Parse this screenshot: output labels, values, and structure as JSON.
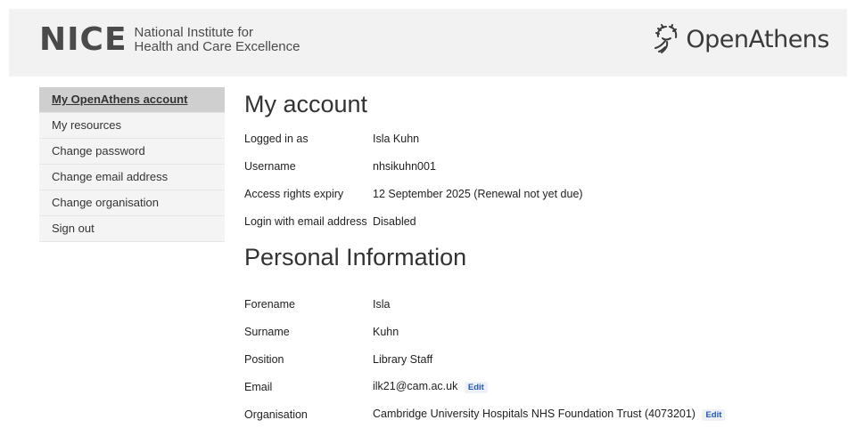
{
  "header": {
    "nice_logo_word": "NICE",
    "nice_line1": "National Institute for",
    "nice_line2": "Health and Care Excellence",
    "brand": "OpenAthens",
    "colors": {
      "header_bg": "#f2f2f2",
      "text": "#4a4a4a"
    }
  },
  "sidebar": {
    "items": [
      {
        "label": "My OpenAthens account",
        "active": true
      },
      {
        "label": "My resources"
      },
      {
        "label": "Change password"
      },
      {
        "label": "Change email address"
      },
      {
        "label": "Change organisation"
      },
      {
        "label": "Sign out"
      }
    ]
  },
  "account": {
    "title": "My account",
    "rows": [
      {
        "label": "Logged in as",
        "value": "Isla Kuhn"
      },
      {
        "label": "Username",
        "value": "nhsikuhn001"
      },
      {
        "label": "Access rights expiry",
        "value": "12 September 2025 (Renewal not yet due)"
      },
      {
        "label": "Login with email address",
        "value": "Disabled"
      }
    ]
  },
  "personal": {
    "title": "Personal Information",
    "rows": [
      {
        "label": "Forename",
        "value": "Isla"
      },
      {
        "label": "Surname",
        "value": "Kuhn"
      },
      {
        "label": "Position",
        "value": "Library Staff"
      },
      {
        "label": "Email",
        "value": "ilk21@cam.ac.uk",
        "edit": "Edit"
      },
      {
        "label": "Organisation",
        "value": "Cambridge University Hospitals NHS Foundation Trust (4073201)",
        "edit": "Edit"
      }
    ]
  },
  "accent": "#2256b8"
}
